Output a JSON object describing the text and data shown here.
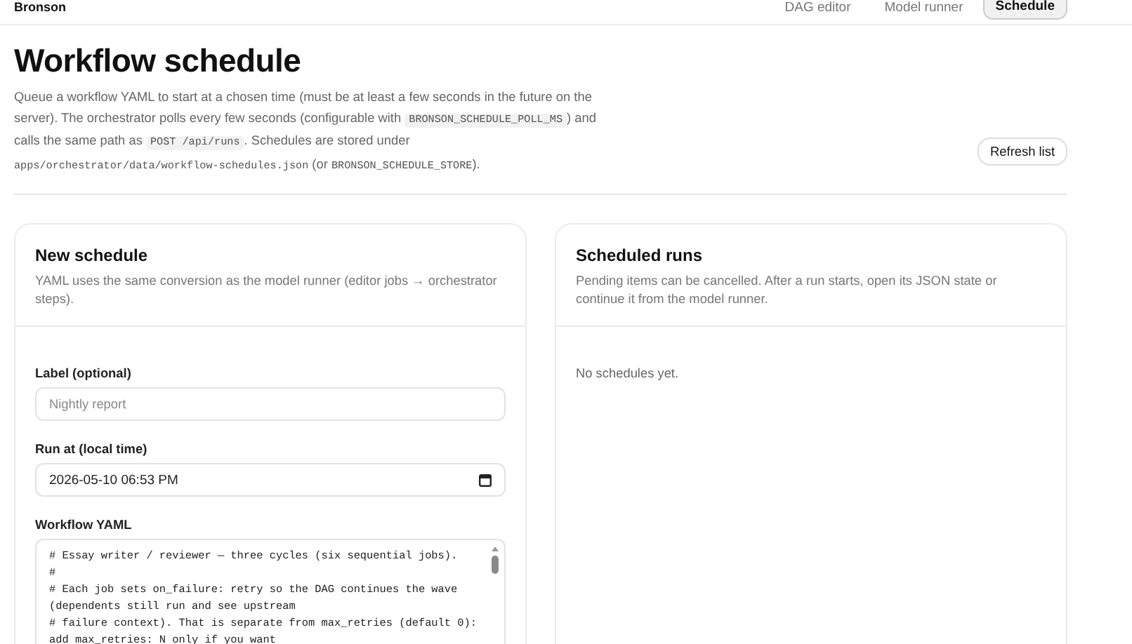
{
  "header": {
    "brand": "Bronson",
    "nav": [
      {
        "label": "DAG editor",
        "selected": false
      },
      {
        "label": "Model runner",
        "selected": false
      },
      {
        "label": "Schedule",
        "selected": true
      }
    ]
  },
  "page": {
    "title": "Workflow schedule",
    "description": [
      {
        "kind": "text",
        "text": "Queue a workflow YAML to start at a chosen time (must be at least a few seconds in the future on the server). The orchestrator polls every few seconds (configurable with "
      },
      {
        "kind": "code",
        "text": "BRONSON_SCHEDULE_POLL_MS"
      },
      {
        "kind": "text",
        "text": ") and calls the same path as "
      },
      {
        "kind": "code",
        "text": "POST /api/runs"
      },
      {
        "kind": "text",
        "text": ". Schedules are stored under "
      },
      {
        "kind": "plaincode",
        "text": "apps/orchestrator/data/workflow-schedules.json"
      },
      {
        "kind": "text",
        "text": " (or "
      },
      {
        "kind": "plaincode",
        "text": "BRONSON_SCHEDULE_STORE"
      },
      {
        "kind": "text",
        "text": ")."
      }
    ],
    "refresh_button": "Refresh list"
  },
  "new_schedule": {
    "title": "New schedule",
    "subtitle": "YAML uses the same conversion as the model runner (editor jobs → orchestrator steps).",
    "label_field": {
      "label": "Label (optional)",
      "placeholder": "Nightly report"
    },
    "run_at_field": {
      "label": "Run at (local time)",
      "value": "2026-05-10 06:53 PM"
    },
    "yaml_field": {
      "label": "Workflow YAML",
      "lines": [
        "# Essay writer / reviewer — three cycles (six sequential jobs).",
        "#",
        "# Each job sets on_failure: retry so the DAG continues the wave",
        "(dependents still run and see upstream",
        "# failure context). That is separate from max_retries (default 0):",
        "add max_retries: N only if you want"
      ]
    }
  },
  "scheduled_runs": {
    "title": "Scheduled runs",
    "subtitle": "Pending items can be cancelled. After a run starts, open its JSON state or continue it from the model runner.",
    "empty_text": "No schedules yet."
  }
}
